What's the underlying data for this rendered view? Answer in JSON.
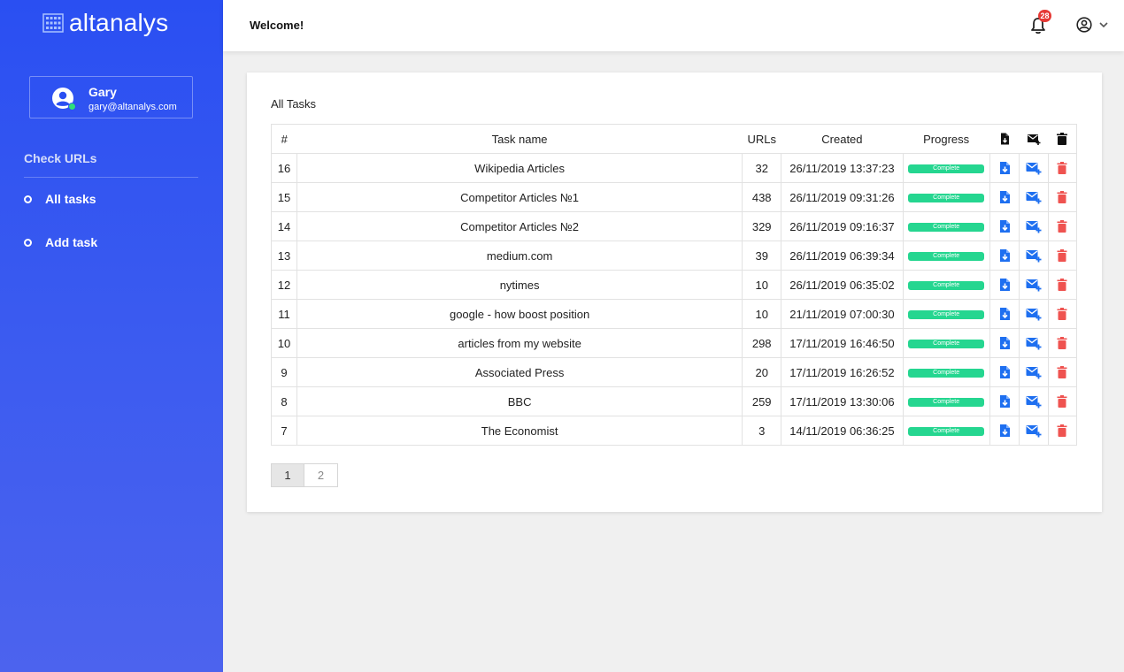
{
  "brand": {
    "name": "altanalys"
  },
  "user": {
    "name": "Gary",
    "email": "gary@altanalys.com"
  },
  "nav": {
    "section": "Check URLs",
    "items": [
      {
        "label": "All tasks"
      },
      {
        "label": "Add task"
      }
    ]
  },
  "topbar": {
    "welcome": "Welcome!",
    "notifications": "28"
  },
  "tasks": {
    "title": "All Tasks",
    "columns": {
      "id": "#",
      "name": "Task name",
      "urls": "URLs",
      "created": "Created",
      "progress": "Progress"
    },
    "rows": [
      {
        "id": "16",
        "name": "Wikipedia Articles",
        "urls": "32",
        "created": "26/11/2019 13:37:23",
        "progress": "Complete"
      },
      {
        "id": "15",
        "name": "Competitor Articles №1",
        "urls": "438",
        "created": "26/11/2019 09:31:26",
        "progress": "Complete"
      },
      {
        "id": "14",
        "name": "Competitor Articles №2",
        "urls": "329",
        "created": "26/11/2019 09:16:37",
        "progress": "Complete"
      },
      {
        "id": "13",
        "name": "medium.com",
        "urls": "39",
        "created": "26/11/2019 06:39:34",
        "progress": "Complete"
      },
      {
        "id": "12",
        "name": "nytimes",
        "urls": "10",
        "created": "26/11/2019 06:35:02",
        "progress": "Complete"
      },
      {
        "id": "11",
        "name": "google - how boost position",
        "urls": "10",
        "created": "21/11/2019 07:00:30",
        "progress": "Complete"
      },
      {
        "id": "10",
        "name": "articles from my website",
        "urls": "298",
        "created": "17/11/2019 16:46:50",
        "progress": "Complete"
      },
      {
        "id": "9",
        "name": "Associated Press",
        "urls": "20",
        "created": "17/11/2019 16:26:52",
        "progress": "Complete"
      },
      {
        "id": "8",
        "name": "BBC",
        "urls": "259",
        "created": "17/11/2019 13:30:06",
        "progress": "Complete"
      },
      {
        "id": "7",
        "name": "The Economist",
        "urls": "3",
        "created": "14/11/2019 06:36:25",
        "progress": "Complete"
      }
    ]
  },
  "pagination": {
    "pages": [
      "1",
      "2"
    ],
    "current": "1"
  },
  "colors": {
    "accent": "#2a4ff2",
    "download": "#1e6ff0",
    "mail": "#1e6ff0",
    "delete": "#ef5350",
    "complete": "#25d690"
  },
  "icons": {
    "header_download": "file-download-icon",
    "header_mail": "mail-add-icon",
    "header_delete": "trash-icon"
  }
}
